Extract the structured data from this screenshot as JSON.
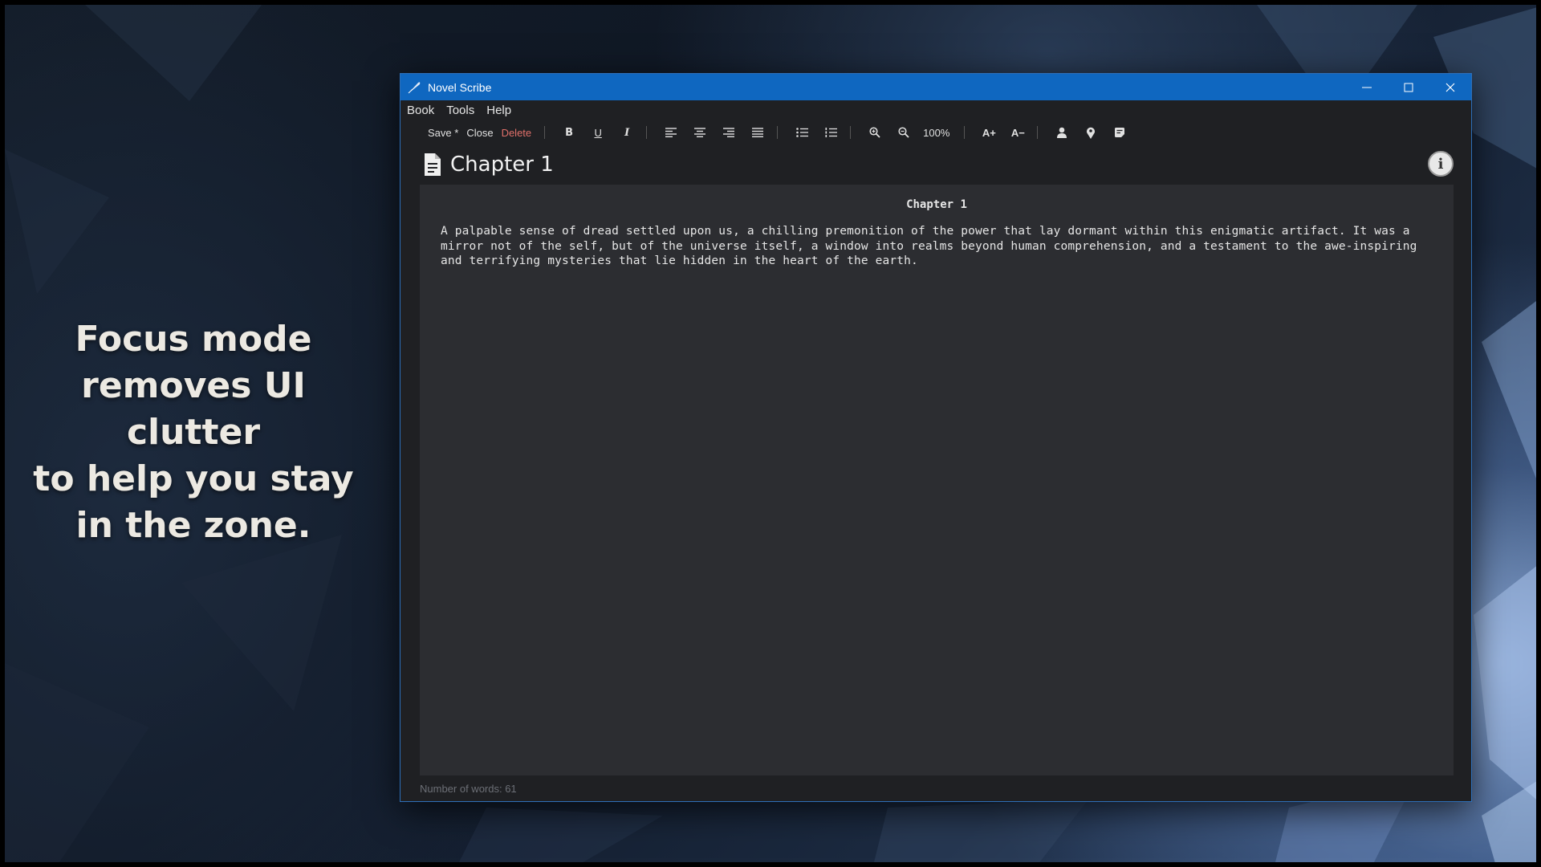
{
  "promo": {
    "lines": [
      "Focus mode",
      "removes UI clutter",
      "to help you stay",
      "in the zone."
    ]
  },
  "window": {
    "title": "Novel Scribe",
    "menu": [
      "Book",
      "Tools",
      "Help"
    ],
    "toolbar": {
      "save_label": "Save *",
      "close_label": "Close",
      "delete_label": "Delete",
      "zoom_label": "100%",
      "bold_label": "B",
      "underline_label": "U",
      "italic_label": "I",
      "font_bigger_label": "A+",
      "font_smaller_label": "A−"
    },
    "document": {
      "title": "Chapter 1",
      "heading": "Chapter 1",
      "body": "A palpable sense of dread settled upon us, a chilling premonition of the power that lay dormant within this enigmatic artifact. It was a mirror not of the self, but of the universe itself, a window into realms beyond human comprehension, and a testament to the awe-inspiring and terrifying mysteries that lie hidden in the heart of the earth."
    },
    "status": "Number of words: 61"
  },
  "colors": {
    "titlebar": "#0f67c0",
    "window_bg": "#1f2023",
    "editor_bg": "#2c2d31",
    "delete": "#e0706a"
  },
  "icons": [
    "quill-icon",
    "minimize-icon",
    "maximize-icon",
    "close-icon",
    "align-left-icon",
    "align-center-icon",
    "align-right-icon",
    "align-justify-icon",
    "bullet-list-icon",
    "numbered-list-icon",
    "zoom-in-icon",
    "zoom-out-icon",
    "character-icon",
    "location-icon",
    "notes-icon",
    "document-icon",
    "info-icon"
  ]
}
